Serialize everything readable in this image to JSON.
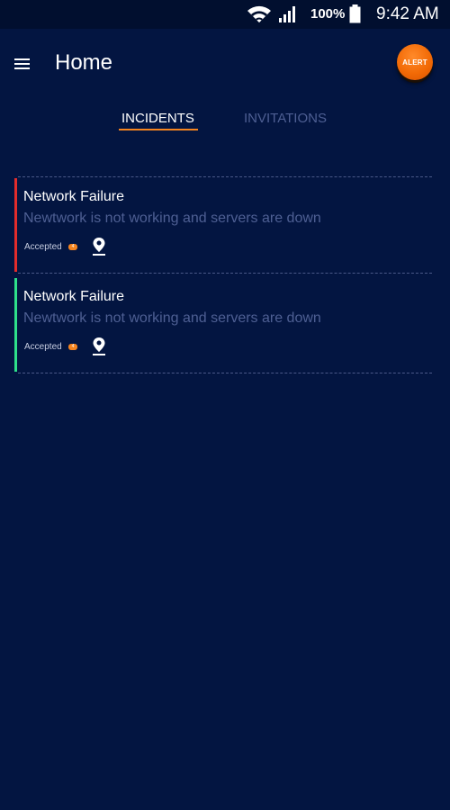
{
  "status_bar": {
    "battery": "100%",
    "time": "9:42 AM",
    "icons": [
      "wifi-icon",
      "signal-icon",
      "battery-icon"
    ]
  },
  "header": {
    "menu_icon": "menu-icon",
    "title": "Home",
    "alert_label": "ALERT",
    "alert_color": "#f26a06"
  },
  "tabs": [
    {
      "label": "INCIDENTS",
      "active": true
    },
    {
      "label": "INVITATIONS",
      "active": false
    }
  ],
  "colors": {
    "background": "#031541",
    "accent": "#f5841f",
    "muted_text": "#4e5f93"
  },
  "incidents": [
    {
      "title": "Network Failure",
      "description": "Newtwork is not working and servers are down",
      "status": "Accepted",
      "count": "4",
      "indicator_color": "#e32c2c",
      "location_icon": "location-pin-icon"
    },
    {
      "title": "Network Failure",
      "description": "Newtwork is not working and servers are down",
      "status": "Accepted",
      "count": "4",
      "indicator_color": "#2ee08a",
      "location_icon": "location-pin-icon"
    }
  ]
}
